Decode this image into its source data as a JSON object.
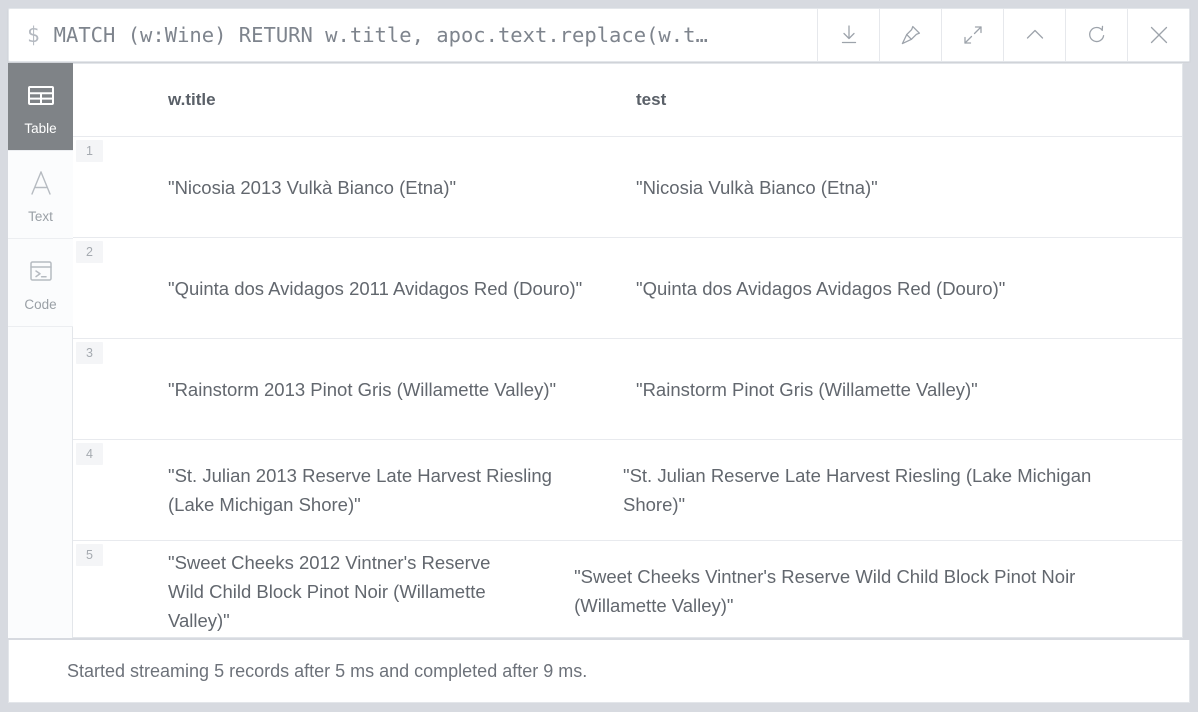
{
  "editor": {
    "prompt": "$",
    "query": "MATCH (w:Wine) RETURN w.title, apoc.text.replace(w.t…",
    "toolbar": [
      {
        "name": "download-icon",
        "label": "Download"
      },
      {
        "name": "pin-icon",
        "label": "Pin"
      },
      {
        "name": "expand-icon",
        "label": "Expand"
      },
      {
        "name": "chevron-up-icon",
        "label": "Collapse"
      },
      {
        "name": "refresh-icon",
        "label": "Rerun"
      },
      {
        "name": "close-icon",
        "label": "Close"
      }
    ]
  },
  "sidebar": {
    "items": [
      {
        "label": "Table",
        "icon": "table-icon",
        "active": true
      },
      {
        "label": "Text",
        "icon": "text-icon",
        "active": false
      },
      {
        "label": "Code",
        "icon": "code-icon",
        "active": false
      }
    ]
  },
  "table": {
    "columns": [
      "w.title",
      "test"
    ],
    "rows": [
      {
        "num": "1",
        "w_title": "\"Nicosia 2013 Vulkà Bianco (Etna)\"",
        "test": "\"Nicosia Vulkà Bianco (Etna)\""
      },
      {
        "num": "2",
        "w_title": "\"Quinta dos Avidagos 2011 Avidagos Red (Douro)\"",
        "test": "\"Quinta dos Avidagos Avidagos Red (Douro)\""
      },
      {
        "num": "3",
        "w_title": "\"Rainstorm 2013 Pinot Gris (Willamette Valley)\"",
        "test": "\"Rainstorm Pinot Gris (Willamette Valley)\""
      },
      {
        "num": "4",
        "w_title": "\"St. Julian 2013 Reserve Late Harvest Riesling (Lake Michigan Shore)\"",
        "test": "\"St. Julian Reserve Late Harvest Riesling (Lake Michigan Shore)\""
      },
      {
        "num": "5",
        "w_title": "\"Sweet Cheeks 2012 Vintner's Reserve Wild Child Block Pinot Noir (Willamette Valley)\"",
        "test": "\"Sweet Cheeks Vintner's Reserve Wild Child Block Pinot Noir (Willamette Valley)\""
      }
    ]
  },
  "status": {
    "message": "Started streaming 5 records after 5 ms and completed after 9 ms."
  },
  "colors": {
    "page_background": "#d7dae0",
    "panel": "#ffffff",
    "border": "#e3e6ea",
    "text_muted": "#62676e",
    "sidebar_active": "#7f8387"
  }
}
